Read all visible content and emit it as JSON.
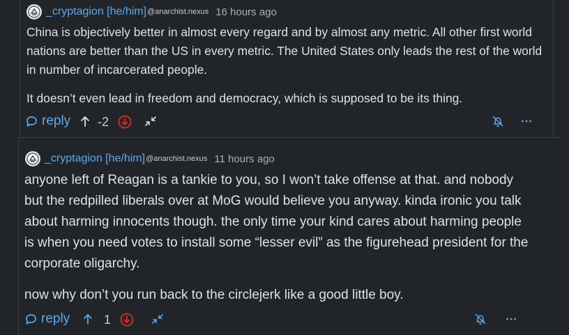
{
  "comments": [
    {
      "username": "_cryptagion [he/him]",
      "instance": "@anarchist.nexus",
      "time": "16 hours ago",
      "paragraphs": [
        "China is objectively better in almost every regard and by almost any metric. All other first world nations are better than the US in every metric. The United States only leads the rest of the world in number of incarcerated people.",
        "It doesn’t even lead in freedom and democracy, which is supposed to be its thing."
      ],
      "reply_label": "reply",
      "score": "-2"
    },
    {
      "username": "_cryptagion [he/him]",
      "instance": "@anarchist.nexus",
      "time": "11 hours ago",
      "paragraphs": [
        "anyone left of Reagan is a tankie to you, so I won’t take offense at that. and nobody but the redpilled liberals over at MoG would believe you anyway. kinda ironic you talk about harming innocents though. the only time your kind cares about harming people is when you need votes to install some “lesser evil” as the figurehead president for the corporate oligarchy.",
        "now why don’t you run back to the circlejerk like a good little boy."
      ],
      "reply_label": "reply",
      "score": "1"
    }
  ],
  "icons": {
    "reply": "speech-bubble-icon",
    "upvote": "arrow-up-icon",
    "downvote": "downvote-circle-icon",
    "collapse": "collapse-arrows-icon",
    "notifications": "bell-off-icon",
    "more": "more-dots-icon"
  },
  "colors": {
    "background": "#212529",
    "link": "#5fa8ee",
    "downvote": "#e02b2b",
    "text": "#dee2e6"
  }
}
